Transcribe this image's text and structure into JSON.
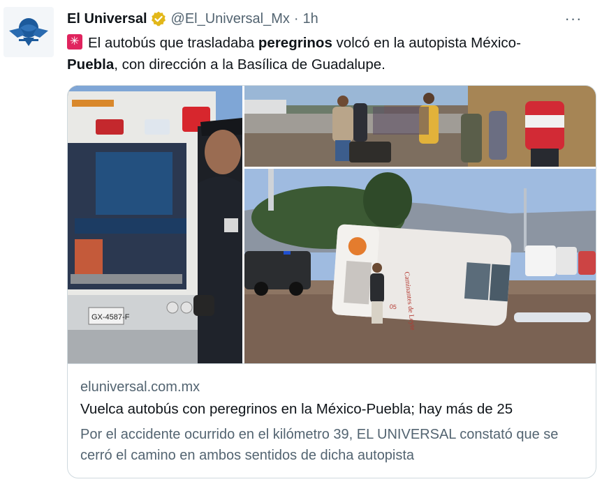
{
  "tweet": {
    "author_name": "El Universal",
    "handle": "@El_Universal_Mx",
    "separator": "·",
    "time": "1h",
    "more_label": "···",
    "text": {
      "part1": "El autobús que trasladaba ",
      "bold1": "peregrinos",
      "part2": " volcó en la autopista México-",
      "bold2": "Puebla",
      "part3": ", con dirección a la Basílica de Guadalupe."
    }
  },
  "link_card": {
    "domain": "eluniversal.com.mx",
    "headline": "Vuelca autobús con peregrinos en la México-Puebla; hay más de 25",
    "description": "Por el accidente ocurrido en el kilómetro 39, EL UNIVERSAL constató que se cerró el camino en ambos sentidos de dicha autopista"
  },
  "media": {
    "plate_text": "GX-4587-F",
    "bus_number": "05",
    "bus_side_text": "Caminantes de Leyte"
  },
  "colors": {
    "verified_gold": "#e2b719",
    "emoji_red": "#e0245e",
    "muted": "#536471",
    "border": "#cfd9de"
  },
  "icons": {
    "avatar": "eagle-globe-logo",
    "verified": "verified-badge-icon",
    "more": "more-options-icon",
    "emoji": "siren-emoji"
  }
}
